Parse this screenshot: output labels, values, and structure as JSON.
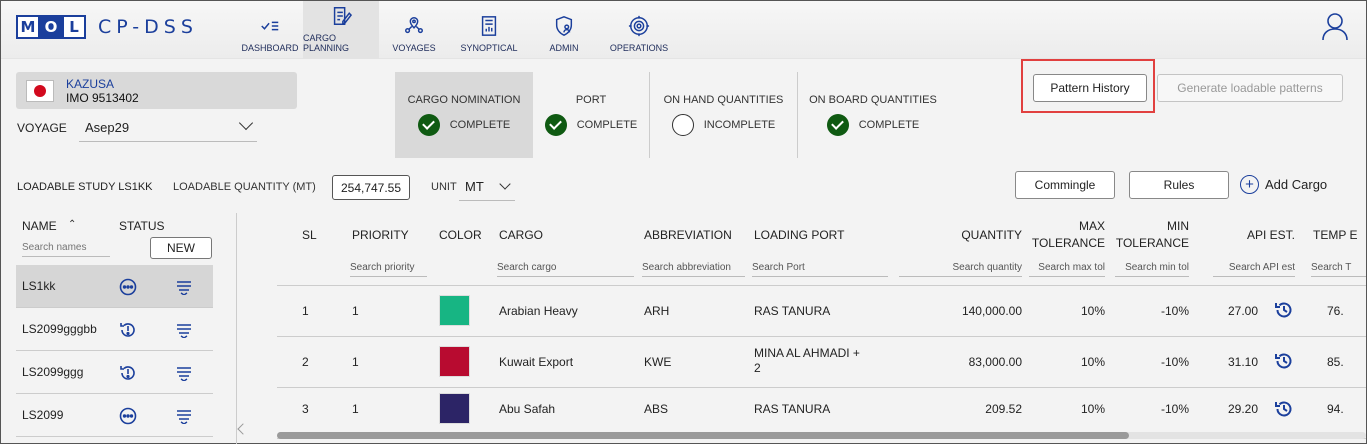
{
  "brand": {
    "logo_letters": [
      "M",
      "O",
      "L"
    ],
    "app_name": "CP-DSS"
  },
  "nav": [
    {
      "label": "DASHBOARD",
      "icon": "dashboard-icon",
      "active": false
    },
    {
      "label": "CARGO PLANNING",
      "icon": "cargo-planning-icon",
      "active": true
    },
    {
      "label": "VOYAGES",
      "icon": "voyages-icon",
      "active": false
    },
    {
      "label": "SYNOPTICAL",
      "icon": "synoptical-icon",
      "active": false
    },
    {
      "label": "ADMIN",
      "icon": "admin-icon",
      "active": false
    },
    {
      "label": "OPERATIONS",
      "icon": "operations-icon",
      "active": false
    }
  ],
  "vessel": {
    "name": "KAZUSA",
    "imo": "IMO 9513402",
    "flag": "japan-flag-icon"
  },
  "voyage": {
    "label": "VOYAGE",
    "value": "Asep29"
  },
  "steps": [
    {
      "title": "CARGO NOMINATION",
      "status": "COMPLETE",
      "done": true
    },
    {
      "title": "PORT",
      "status": "COMPLETE",
      "done": true
    },
    {
      "title": "ON HAND QUANTITIES",
      "status": "INCOMPLETE",
      "done": false
    },
    {
      "title": "ON BOARD QUANTITIES",
      "status": "COMPLETE",
      "done": true
    }
  ],
  "buttons": {
    "pattern_history": "Pattern History",
    "generate_patterns": "Generate loadable patterns",
    "commingle": "Commingle",
    "rules": "Rules",
    "add_cargo": "Add Cargo"
  },
  "study": {
    "label": "LOADABLE STUDY LS1KK",
    "quantity_label": "LOADABLE QUANTITY (MT)",
    "quantity_value": "254,747.55",
    "unit_label": "UNIT",
    "unit_value": "MT"
  },
  "studies_list": {
    "name_header": "NAME",
    "status_header": "STATUS",
    "search_placeholder": "Search names",
    "new_label": "NEW",
    "items": [
      {
        "name": "LS1kk",
        "status": "in-progress-icon",
        "selected": true
      },
      {
        "name": "LS2099gggbb",
        "status": "alert-icon",
        "selected": false
      },
      {
        "name": "LS2099ggg",
        "status": "alert-icon",
        "selected": false
      },
      {
        "name": "LS2099",
        "status": "in-progress-icon",
        "selected": false
      }
    ]
  },
  "cargo_table": {
    "headers": {
      "sl": "SL",
      "priority": "PRIORITY",
      "color": "COLOR",
      "cargo": "CARGO",
      "abbreviation": "ABBREVIATION",
      "loading_port": "LOADING PORT",
      "quantity": "QUANTITY",
      "max_tol_1": "MAX",
      "max_tol_2": "TOLERANCE",
      "min_tol_1": "MIN",
      "min_tol_2": "TOLERANCE",
      "api": "API EST.",
      "temp": "TEMP E"
    },
    "search": {
      "priority": "Search priority",
      "cargo": "Search cargo",
      "abbreviation": "Search abbreviation",
      "port": "Search Port",
      "quantity": "Search quantity",
      "max_tol": "Search max tol",
      "min_tol": "Search min tol",
      "api": "Search API est",
      "temp": "Search T"
    },
    "rows": [
      {
        "sl": "1",
        "priority": "1",
        "color": "#17b583",
        "cargo": "Arabian Heavy",
        "abbreviation": "ARH",
        "port_1": "RAS TANURA",
        "port_2": "",
        "quantity": "140,000.00",
        "max_tol": "10%",
        "min_tol": "-10%",
        "api": "27.00",
        "temp": "76."
      },
      {
        "sl": "2",
        "priority": "1",
        "color": "#b80b30",
        "cargo": "Kuwait Export",
        "abbreviation": "KWE",
        "port_1": "MINA AL AHMADI +",
        "port_2": "2",
        "quantity": "83,000.00",
        "max_tol": "10%",
        "min_tol": "-10%",
        "api": "31.10",
        "temp": "85."
      },
      {
        "sl": "3",
        "priority": "1",
        "color": "#2c2466",
        "cargo": "Abu Safah",
        "abbreviation": "ABS",
        "port_1": "RAS TANURA",
        "port_2": "",
        "quantity": "209.52",
        "max_tol": "10%",
        "min_tol": "-10%",
        "api": "29.20",
        "temp": "94."
      }
    ]
  }
}
